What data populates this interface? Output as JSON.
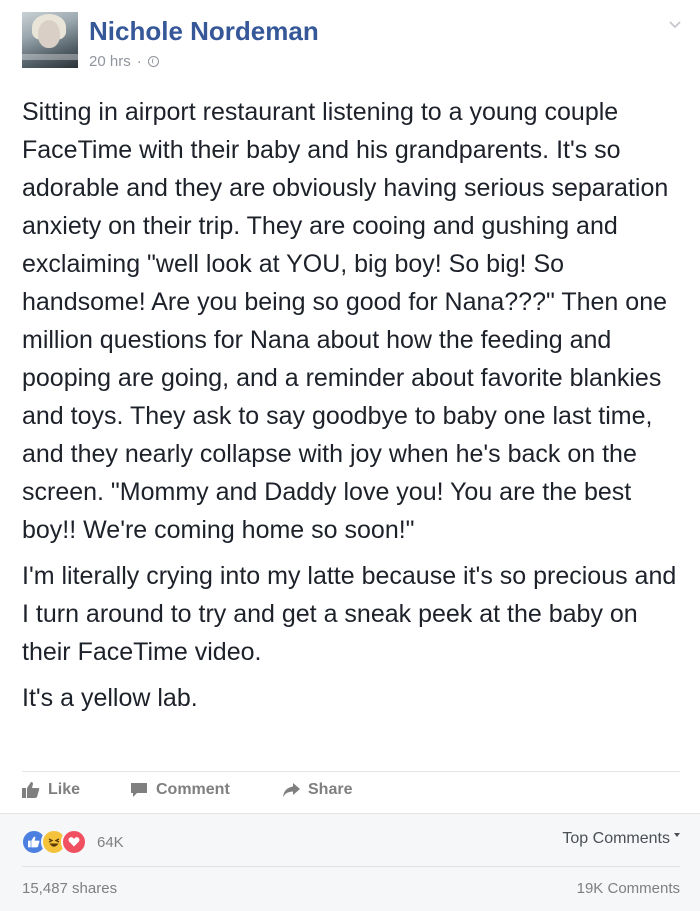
{
  "post": {
    "author": "Nichole Nordeman",
    "timestamp": "20 hrs",
    "separator": "·",
    "paragraphs": [
      "Sitting in airport restaurant listening to a young couple FaceTime with their baby and his grandparents. It's so adorable and they are obviously having serious separation anxiety on their trip. They are cooing and gushing and exclaiming \"well look at YOU, big boy! So big! So handsome! Are you being so good for Nana???\" Then one million questions for Nana about how the feeding and pooping are going, and a reminder about favorite blankies and toys. They ask to say goodbye to baby one last time, and they nearly collapse with joy when he's back on the screen. \"Mommy and Daddy love you! You are the best boy!! We're coming home so soon!\"",
      "I'm literally crying into my latte because it's so precious and I turn around to try and get a sneak peek at the baby on their FaceTime video.",
      "It's a yellow lab."
    ]
  },
  "actions": {
    "like_label": "Like",
    "comment_label": "Comment",
    "share_label": "Share"
  },
  "footer": {
    "reaction_count": "64K",
    "top_comments_label": "Top Comments",
    "shares_label": "15,487 shares",
    "comments_label": "19K Comments"
  },
  "icons": {
    "privacy": "globe-icon",
    "menu": "chevron-down-icon",
    "like": "thumbs-up-icon",
    "comment": "speech-bubble-icon",
    "share": "share-arrow-icon",
    "reactions": [
      "like-reaction-icon",
      "haha-reaction-icon",
      "love-reaction-icon"
    ]
  },
  "colors": {
    "author": "#365899",
    "text": "#1d2129",
    "muted": "#90949c",
    "action": "#7f7f7f",
    "footer_bg": "#f6f7f9"
  }
}
